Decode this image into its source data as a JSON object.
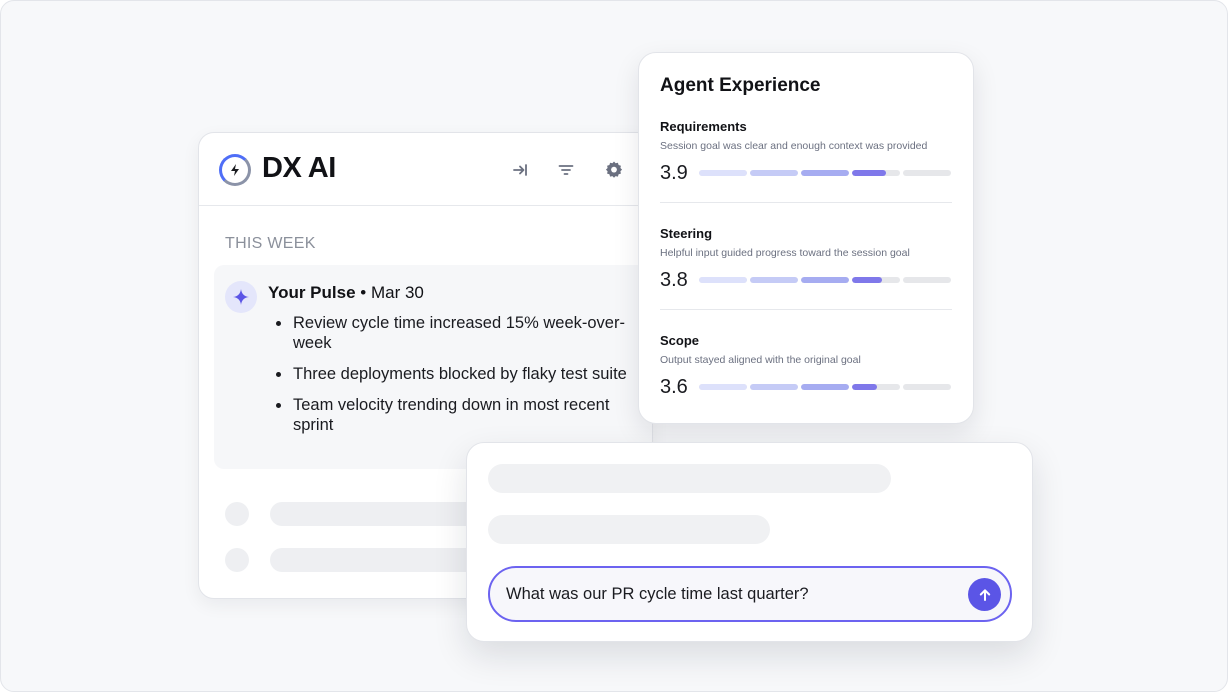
{
  "app": {
    "title": "DX AI",
    "accent_color": "#5b55e6"
  },
  "header": {
    "icons": [
      "collapse-arrow-icon",
      "filter-icon",
      "gear-icon"
    ]
  },
  "feed": {
    "section_label": "THIS WEEK",
    "pulse": {
      "icon": "sparkle-icon",
      "title": "Your Pulse",
      "separator": "•",
      "date": "Mar 30",
      "items": [
        "Review cycle time increased 15% week-over-week",
        "Three deployments blocked by flaky test suite",
        "Team velocity trending down in most recent sprint"
      ]
    }
  },
  "agent_experience": {
    "title": "Agent Experience",
    "metrics": [
      {
        "name": "Requirements",
        "description": "Session goal was clear and enough context was provided",
        "score": "3.9",
        "segment_fill": [
          1,
          1,
          1,
          0.7,
          0
        ]
      },
      {
        "name": "Steering",
        "description": "Helpful input guided progress toward the session goal",
        "score": "3.8",
        "segment_fill": [
          1,
          1,
          1,
          0.62,
          0
        ]
      },
      {
        "name": "Scope",
        "description": "Output stayed aligned with the original goal",
        "score": "3.6",
        "segment_fill": [
          1,
          1,
          1,
          0.52,
          0
        ]
      }
    ],
    "segment_colors": [
      "#dde1fb",
      "#c5cbf6",
      "#a6acf1",
      "#7f78ea",
      "#e6e7ea"
    ]
  },
  "chat": {
    "input_value": "What was our PR cycle time last quarter?",
    "send_icon": "arrow-up-icon"
  }
}
